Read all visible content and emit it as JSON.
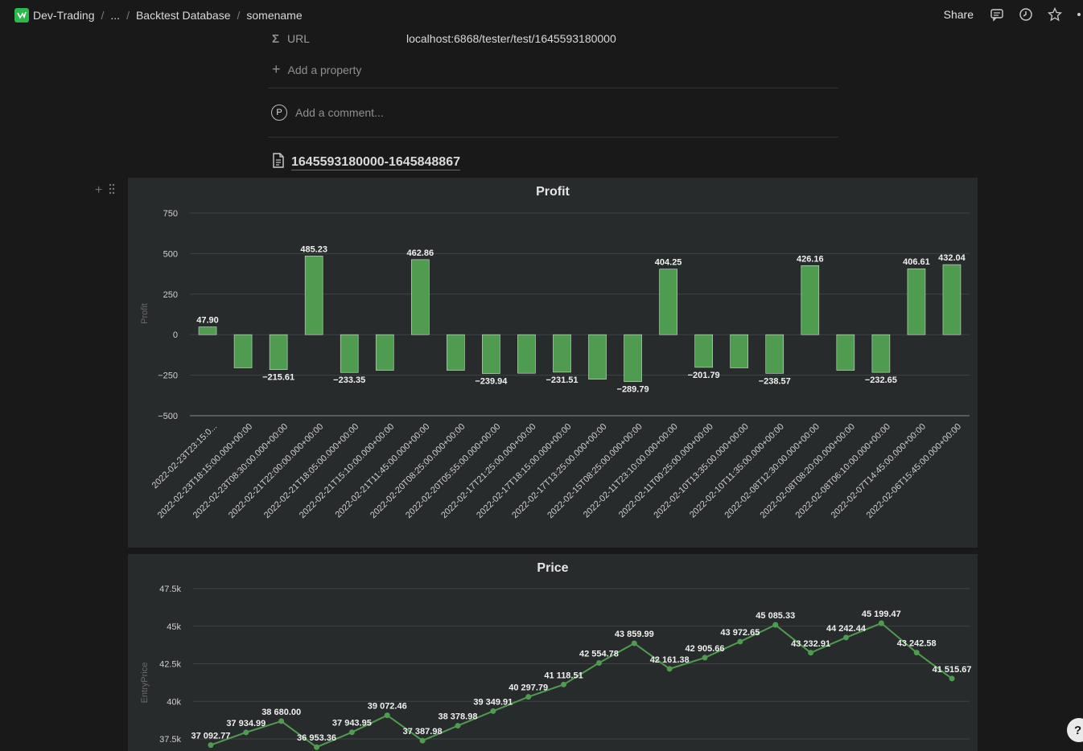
{
  "breadcrumb": {
    "workspace": "Dev-Trading",
    "ellipsis": "...",
    "parent": "Backtest Database",
    "page": "somename",
    "separator": "/"
  },
  "topbar": {
    "share_label": "Share"
  },
  "properties": [
    {
      "name": "URL",
      "value": "localhost:6868/tester/test/1645593180000"
    }
  ],
  "add_property_label": "Add a property",
  "comment": {
    "avatar_letter": "P",
    "placeholder": "Add a comment..."
  },
  "file_link": "1645593180000-1645848867",
  "help_label": "?",
  "chart_data": [
    {
      "type": "bar",
      "title": "Profit",
      "ylabel": "Profit",
      "xlabel": "",
      "ylim": [
        -500,
        750
      ],
      "yticks": [
        750,
        500,
        250,
        0,
        -250,
        -500
      ],
      "ytick_labels": [
        "750",
        "500",
        "250",
        "0",
        "−250",
        "−500"
      ],
      "grid": true,
      "color": "#4f9b4f",
      "categories": [
        "2022-02-23T23:15:0...",
        "2022-02-23T18:15:00.000+00:00",
        "2022-02-23T08:30:00.000+00:00",
        "2022-02-21T22:00:00.000+00:00",
        "2022-02-21T18:05:00.000+00:00",
        "2022-02-21T15:10:00.000+00:00",
        "2022-02-21T11:45:00.000+00:00",
        "2022-02-20T08:25:00.000+00:00",
        "2022-02-20T05:55:00.000+00:00",
        "2022-02-17T21:25:00.000+00:00",
        "2022-02-17T18:15:00.000+00:00",
        "2022-02-17T13:25:00.000+00:00",
        "2022-02-15T08:25:00.000+00:00",
        "2022-02-11T23:10:00.000+00:00",
        "2022-02-11T00:25:00.000+00:00",
        "2022-02-10T13:35:00.000+00:00",
        "2022-02-10T11:35:00.000+00:00",
        "2022-02-08T12:30:00.000+00:00",
        "2022-02-08T08:20:00.000+00:00",
        "2022-02-08T06:10:00.000+00:00",
        "2022-02-07T14:45:00.000+00:00",
        "2022-02-06T15:45:00.000+00:00"
      ],
      "values": [
        47.9,
        -205,
        -215.61,
        485.23,
        -233.35,
        -220,
        462.86,
        -220,
        -239.94,
        -238,
        -231.51,
        -275,
        -289.79,
        404.25,
        -201.79,
        -205,
        -238.57,
        426.16,
        -220,
        -232.65,
        406.61,
        432.04
      ],
      "data_labels": [
        "47.90",
        "",
        "−215.61",
        "485.23",
        "−233.35",
        "",
        "462.86",
        "",
        "−239.94",
        "",
        "−231.51",
        "",
        "−289.79",
        "404.25",
        "−201.79",
        "",
        "−238.57",
        "426.16",
        "",
        "−232.65",
        "406.61",
        "432.04"
      ]
    },
    {
      "type": "line",
      "title": "Price",
      "ylabel": "EntryPrice",
      "xlabel": "",
      "ylim": [
        37500,
        47500
      ],
      "yticks": [
        47500,
        45000,
        42500,
        40000,
        37500
      ],
      "ytick_labels": [
        "47.5k",
        "45k",
        "42.5k",
        "40k",
        "37.5k"
      ],
      "grid": true,
      "color": "#4f9b4f",
      "values": [
        37092.77,
        37934.99,
        38680.0,
        36953.36,
        37943.95,
        39072.46,
        37387.98,
        38378.98,
        39349.91,
        40297.79,
        41118.51,
        42554.78,
        43859.99,
        42161.38,
        42905.66,
        43972.65,
        45085.33,
        43232.91,
        44242.44,
        45199.47,
        43242.58,
        41515.67
      ],
      "data_labels": [
        "37 092.77",
        "37 934.99",
        "38 680.00",
        "36 953.36",
        "37 943.95",
        "39 072.46",
        "37 387.98",
        "38 378.98",
        "39 349.91",
        "40 297.79",
        "41 118.51",
        "42 554.78",
        "43 859.99",
        "42 161.38",
        "42 905.66",
        "43 972.65",
        "45 085.33",
        "43 232.91",
        "44 242.44",
        "45 199.47",
        "43 242.58",
        "41 515.67"
      ]
    }
  ]
}
